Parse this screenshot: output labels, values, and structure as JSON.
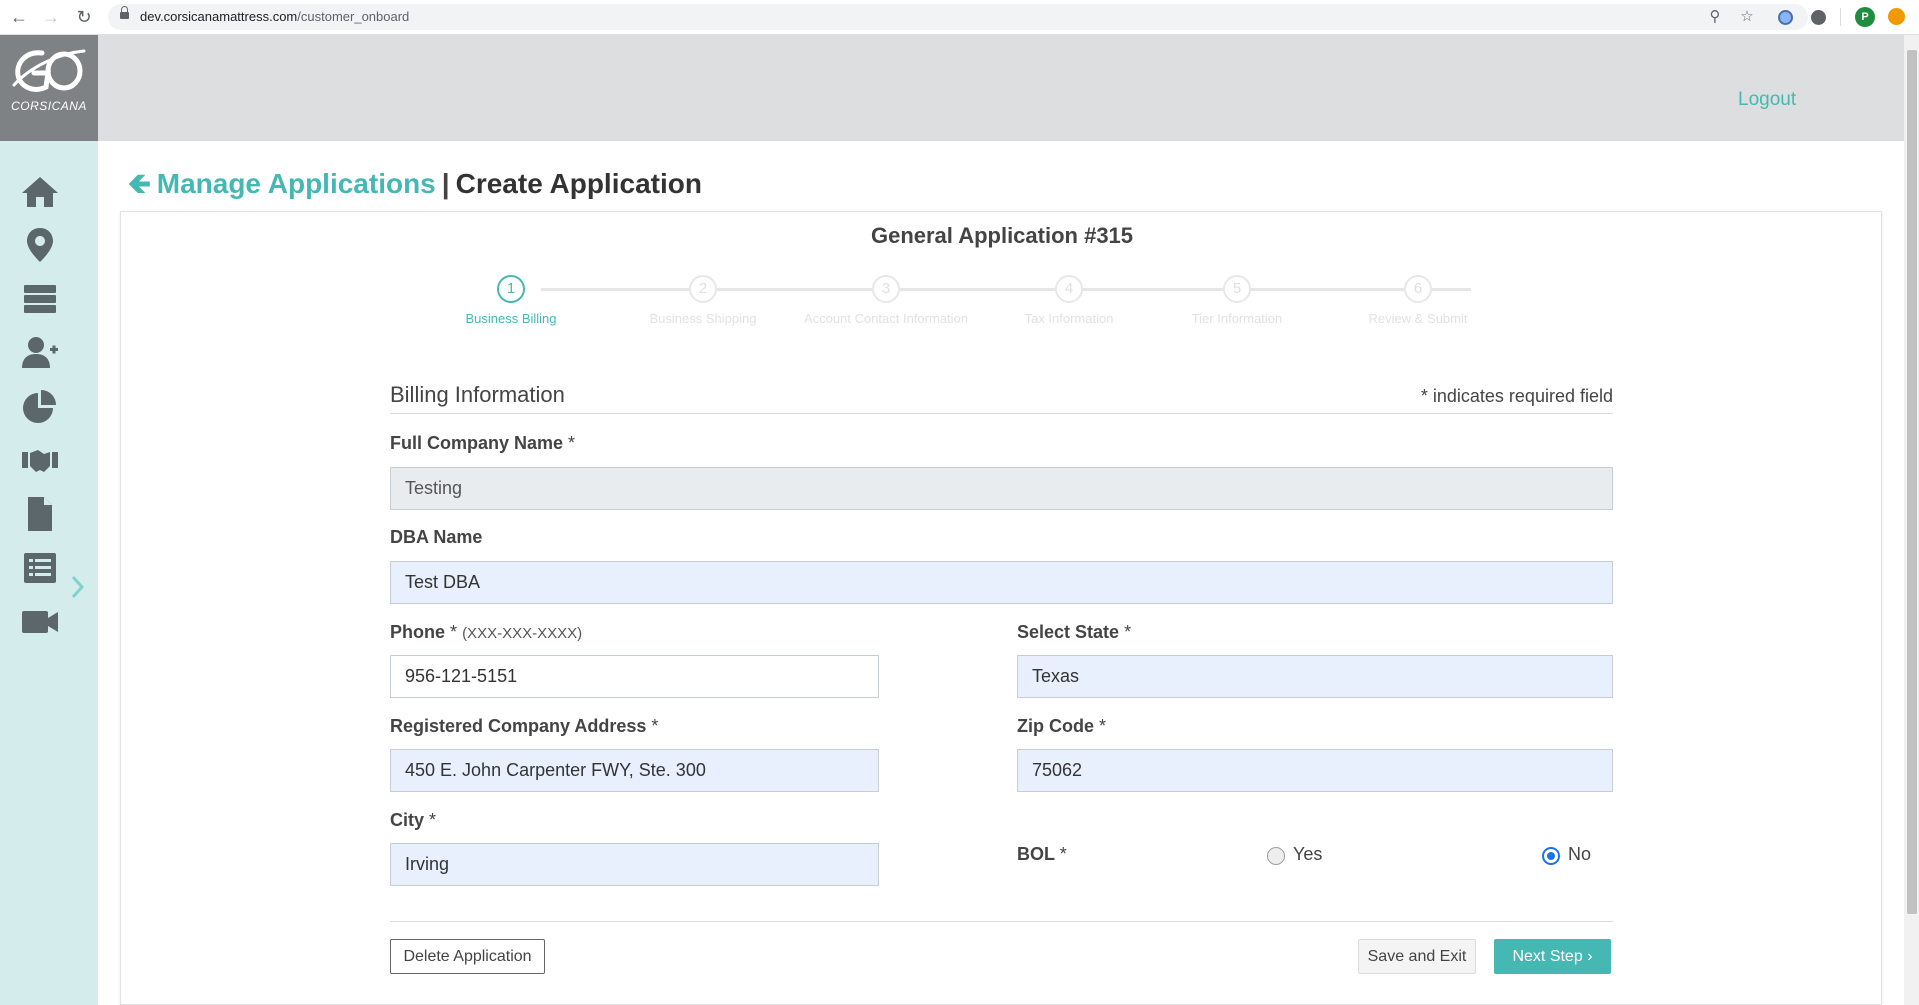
{
  "browser": {
    "url_domain": "dev.corsicanamattress.com",
    "url_path": "/customer_onboard",
    "profile_initial": "P"
  },
  "sidebar": {
    "logo_text": "CORSICANA",
    "items": [
      {
        "icon": "home-icon"
      },
      {
        "icon": "map-pin-icon"
      },
      {
        "icon": "server-icon"
      },
      {
        "icon": "user-plus-icon"
      },
      {
        "icon": "pie-chart-icon"
      },
      {
        "icon": "handshake-icon"
      },
      {
        "icon": "document-icon"
      },
      {
        "icon": "list-icon"
      },
      {
        "icon": "video-icon"
      }
    ]
  },
  "header": {
    "logout_label": "Logout"
  },
  "breadcrumb": {
    "parent": "Manage Applications",
    "separator": "|",
    "current": "Create Application"
  },
  "application": {
    "title": "General Application #315"
  },
  "stepper": {
    "steps": [
      {
        "num": "1",
        "label": "Business Billing",
        "active": true
      },
      {
        "num": "2",
        "label": "Business Shipping",
        "active": false
      },
      {
        "num": "3",
        "label": "Account Contact Information",
        "active": false
      },
      {
        "num": "4",
        "label": "Tax Information",
        "active": false
      },
      {
        "num": "5",
        "label": "Tier Information",
        "active": false
      },
      {
        "num": "6",
        "label": "Review & Submit",
        "active": false
      }
    ]
  },
  "form": {
    "section_title": "Billing Information",
    "required_note": "* indicates required field",
    "company_name": {
      "label": "Full Company Name",
      "required": "*",
      "value": "Testing"
    },
    "dba_name": {
      "label": "DBA Name",
      "value": "Test DBA"
    },
    "phone": {
      "label": "Phone",
      "required": "*",
      "hint": "(XXX-XXX-XXXX)",
      "value": "956-121-5151"
    },
    "state": {
      "label": "Select State",
      "required": "*",
      "value": "Texas"
    },
    "address": {
      "label": "Registered Company Address",
      "required": "*",
      "value": "450 E. John Carpenter FWY, Ste. 300"
    },
    "zip": {
      "label": "Zip Code",
      "required": "*",
      "value": "75062"
    },
    "city": {
      "label": "City",
      "required": "*",
      "value": "Irving"
    },
    "bol": {
      "label": "BOL",
      "required": "*",
      "yes_label": "Yes",
      "no_label": "No",
      "selected": "No"
    }
  },
  "buttons": {
    "delete_label": "Delete Application",
    "save_label": "Save and Exit",
    "next_label": "Next Step",
    "next_icon": "chevron-right-icon"
  },
  "colors": {
    "accent": "#46b8b3",
    "sidebar_bg": "#d5ecec",
    "logo_bg": "#7e8284",
    "header_bg": "#dcdedf"
  }
}
